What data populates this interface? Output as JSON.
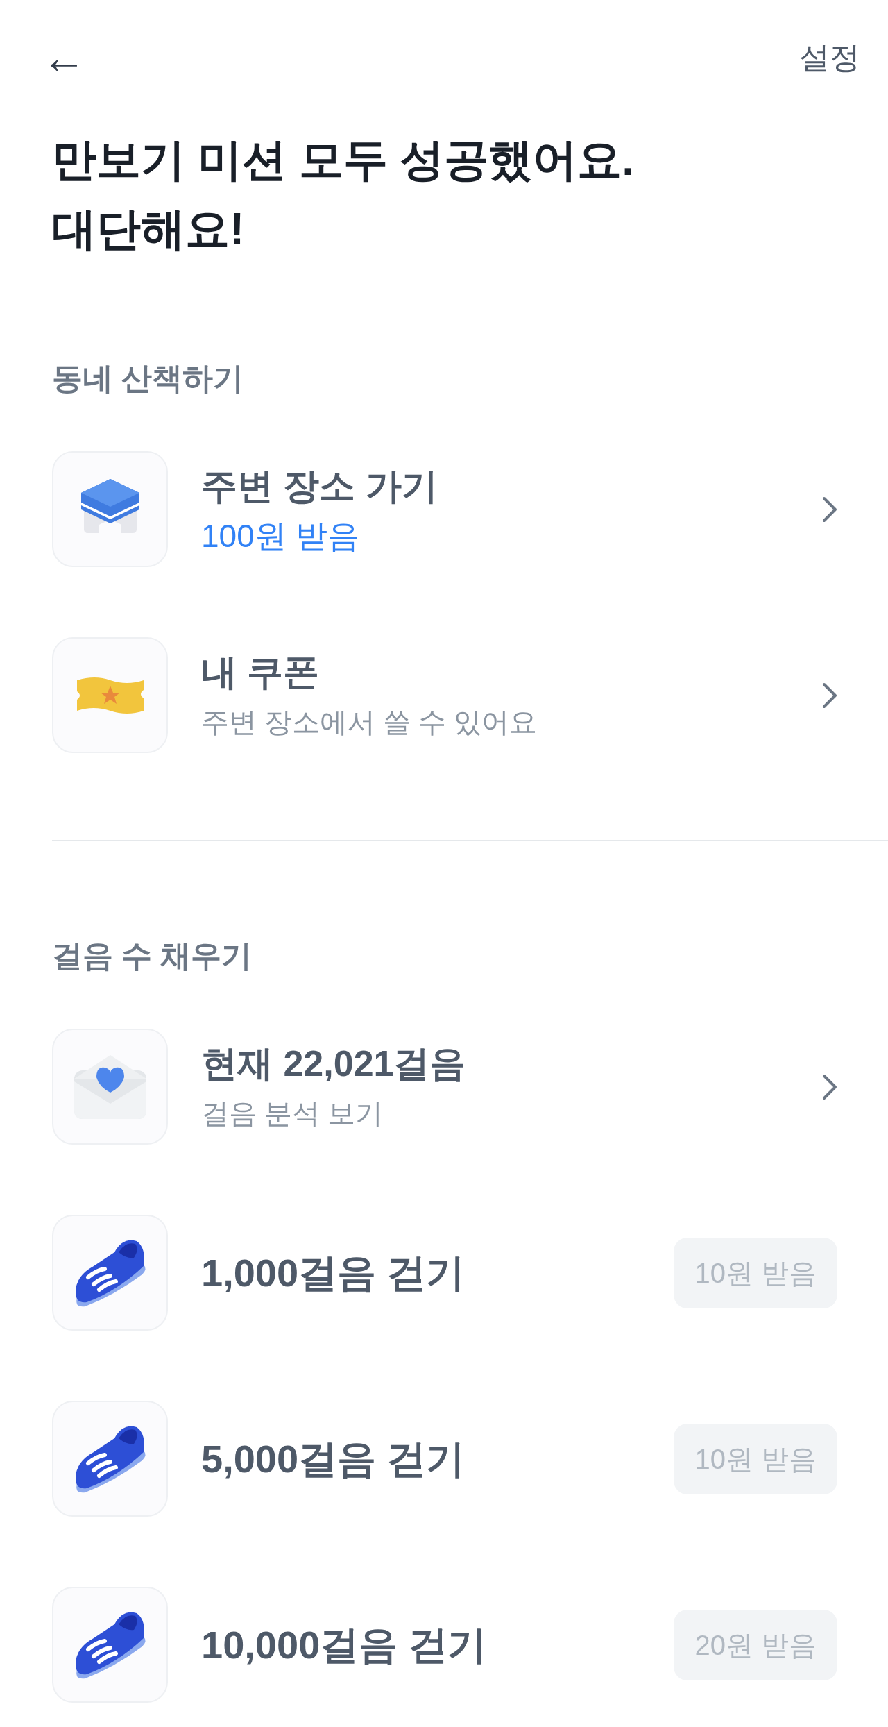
{
  "header": {
    "back": "←",
    "settings": "설정"
  },
  "title_lines": [
    "만보기 미션 모두 성공했어요.",
    "대단해요!"
  ],
  "sections": [
    {
      "heading": "동네 산책하기",
      "items": [
        {
          "kind": "link",
          "title": "주변 장소 가기",
          "subtitle": "100원 받음",
          "highlighted": true
        },
        {
          "kind": "link",
          "title": "내 쿠폰",
          "subtitle": "주변 장소에서 쓸 수 있어요",
          "highlighted": false
        }
      ]
    },
    {
      "heading": "걸음 수 채우기",
      "items": [
        {
          "kind": "link",
          "title": "현재 22,021걸음",
          "subtitle": "걸음 분석 보기",
          "highlighted": false
        },
        {
          "kind": "reward",
          "title": "1,000걸음 걷기",
          "reward": "10원 받음",
          "disabled": true
        },
        {
          "kind": "reward",
          "title": "5,000걸음 걷기",
          "reward": "10원 받음",
          "disabled": true
        },
        {
          "kind": "reward",
          "title": "10,000걸음 걷기",
          "reward": "20원 받음",
          "disabled": true
        }
      ]
    }
  ]
}
